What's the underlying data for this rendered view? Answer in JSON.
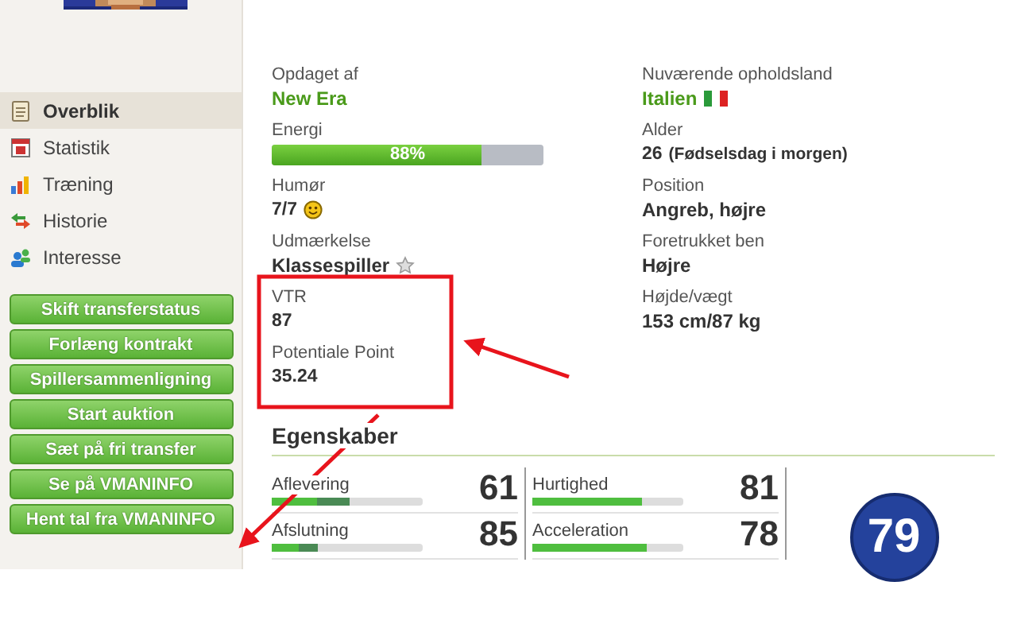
{
  "sidebar": {
    "nav": [
      {
        "label": "Overblik",
        "selected": true
      },
      {
        "label": "Statistik",
        "selected": false
      },
      {
        "label": "Træning",
        "selected": false
      },
      {
        "label": "Historie",
        "selected": false
      },
      {
        "label": "Interesse",
        "selected": false
      }
    ],
    "buttons": [
      "Skift transferstatus",
      "Forlæng kontrakt",
      "Spillersammenligning",
      "Start auktion",
      "Sæt på fri transfer",
      "Se på VMANINFO",
      "Hent tal fra VMANINFO"
    ]
  },
  "left_fields": [
    {
      "kind": "link",
      "label": "Opdaget af",
      "value": "New Era"
    },
    {
      "kind": "meter",
      "label": "Energi",
      "value": "88%",
      "level": 0.77
    },
    {
      "kind": "mood",
      "label": "Humør",
      "value": "7/7"
    },
    {
      "kind": "award",
      "label": "Udmærkelse",
      "value": "Klassespiller"
    },
    {
      "kind": "text",
      "label": "VTR",
      "value": "87"
    },
    {
      "kind": "text",
      "label": "Potentiale Point",
      "value": "35.24"
    }
  ],
  "right_fields": [
    {
      "kind": "country",
      "label": "Nuværende opholdsland",
      "value": "Italien"
    },
    {
      "kind": "age",
      "label": "Alder",
      "value": "26",
      "note": "(Fødselsdag i morgen)"
    },
    {
      "kind": "text",
      "label": "Position",
      "value": "Angreb, højre"
    },
    {
      "kind": "text",
      "label": "Foretrukket ben",
      "value": "Højre"
    },
    {
      "kind": "text",
      "label": "Højde/vægt",
      "value": "153 cm/87 kg"
    }
  ],
  "skills": {
    "title": "Egenskaber",
    "columns": [
      [
        {
          "name": "Aflevering",
          "value": "61",
          "level": 0.52
        },
        {
          "name": "Afslutning",
          "value": "85",
          "level": 0.3
        }
      ],
      [
        {
          "name": "Hurtighed",
          "value": "81",
          "level": 0.73
        },
        {
          "name": "Acceleration",
          "value": "78",
          "level": 0.76
        }
      ]
    ],
    "overall": "79"
  }
}
